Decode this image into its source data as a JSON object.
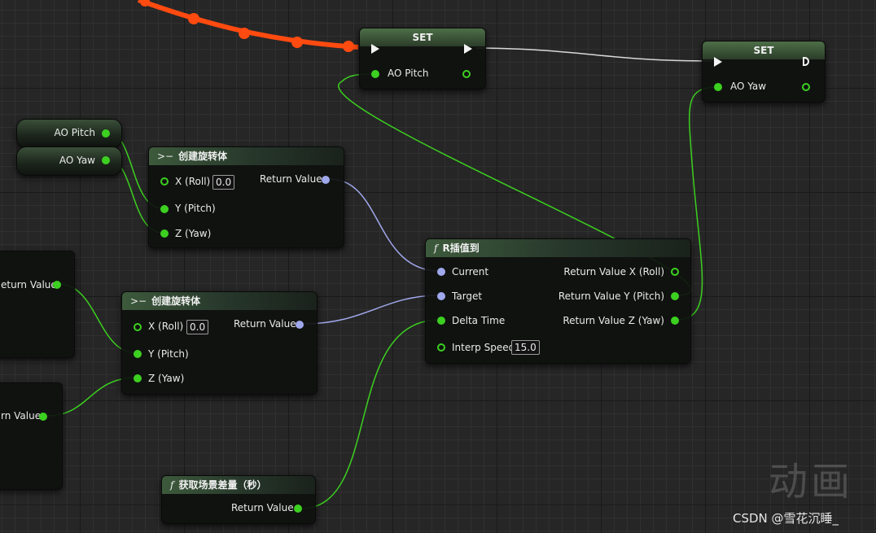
{
  "nodes": {
    "set_pitch": {
      "title": "SET",
      "pin": "AO Pitch"
    },
    "set_yaw": {
      "title": "SET",
      "pin": "AO Yaw"
    },
    "get_pitch": {
      "label": "AO Pitch"
    },
    "get_yaw": {
      "label": "AO Yaw"
    },
    "make_rot_1": {
      "title": "创建旋转体",
      "x": "X (Roll)",
      "x_value": "0.0",
      "y": "Y (Pitch)",
      "z": "Z (Yaw)",
      "out": "Return Value"
    },
    "make_rot_2": {
      "title": "创建旋转体",
      "x": "X (Roll)",
      "x_value": "0.0",
      "y": "Y (Pitch)",
      "z": "Z (Yaw)",
      "out": "Return Value"
    },
    "rinterp": {
      "title": "R插值到",
      "current": "Current",
      "target": "Target",
      "delta": "Delta Time",
      "speed": "Interp Speed",
      "speed_value": "15.0",
      "out_x": "Return Value X (Roll)",
      "out_y": "Return Value Y (Pitch)",
      "out_z": "Return Value Z (Yaw)"
    },
    "world_delta": {
      "title": "获取场景差量（秒）",
      "out": "Return Value"
    },
    "left_top": {
      "out": "eturn Value"
    },
    "left_bottom": {
      "out": "rn Value"
    }
  },
  "watermark": "动画",
  "footer": "CSDN @雪花沉睡_",
  "colors": {
    "exec_wire": "#ff4a10",
    "float_wire": "#3cd020",
    "rotator_wire": "#a0a8ec",
    "exec_pin": "#f4f4f4"
  }
}
